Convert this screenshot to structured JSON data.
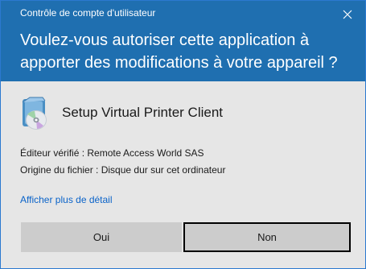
{
  "window": {
    "title": "Contrôle de compte d'utilisateur"
  },
  "header": {
    "question": "Voulez-vous autoriser cette application à apporter des modifications à votre appareil ?"
  },
  "program": {
    "icon": "installer-cd-icon",
    "name": "Setup Virtual Printer Client"
  },
  "details": {
    "publisher": "Éditeur vérifié : Remote Access World SAS",
    "origin": "Origine du fichier : Disque dur sur cet ordinateur"
  },
  "link": {
    "more_details": "Afficher plus de détail"
  },
  "buttons": {
    "yes": "Oui",
    "no": "Non"
  },
  "colors": {
    "header_background": "#1f6fb0",
    "body_background": "#e6e6e6",
    "link": "#0a63c9",
    "button_background": "#cccccc"
  }
}
